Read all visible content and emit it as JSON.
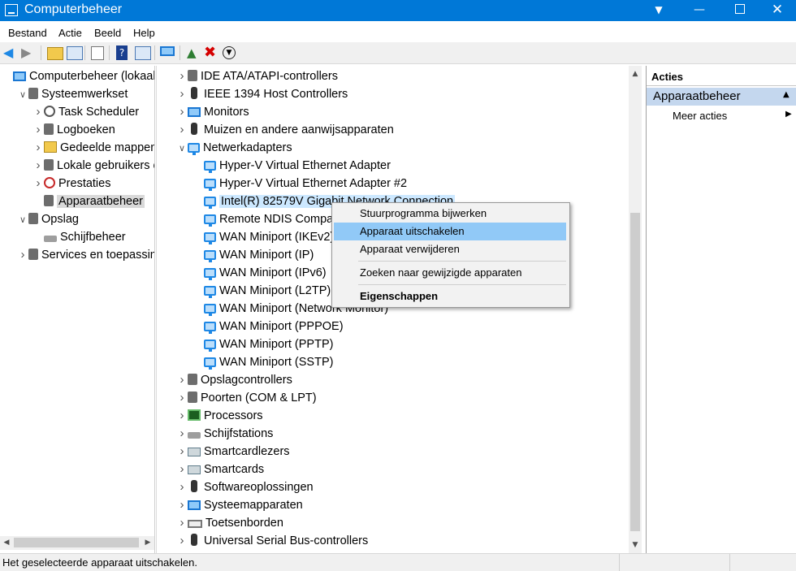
{
  "window": {
    "title": "Computerbeheer",
    "controls": [
      "help-icon",
      "minimize",
      "maximize",
      "close"
    ]
  },
  "menubar": [
    "Bestand",
    "Actie",
    "Beeld",
    "Help"
  ],
  "left_tree": [
    {
      "label": "Computerbeheer (lokaal)",
      "level": 0,
      "expander": "",
      "icon": "computer-icon"
    },
    {
      "label": "Systeemwerkset",
      "level": 1,
      "expander": "expanded",
      "icon": "tools-icon"
    },
    {
      "label": "Task Scheduler",
      "level": 2,
      "expander": "collapsed",
      "icon": "clock-icon"
    },
    {
      "label": "Logboeken",
      "level": 2,
      "expander": "collapsed",
      "icon": "log-icon"
    },
    {
      "label": "Gedeelde mappen",
      "level": 2,
      "expander": "collapsed",
      "icon": "shared-folder-icon"
    },
    {
      "label": "Lokale gebruikers en",
      "level": 2,
      "expander": "collapsed",
      "icon": "users-icon"
    },
    {
      "label": "Prestaties",
      "level": 2,
      "expander": "collapsed",
      "icon": "performance-icon"
    },
    {
      "label": "Apparaatbeheer",
      "level": 2,
      "expander": "",
      "icon": "device-manager-icon",
      "selected": true
    },
    {
      "label": "Opslag",
      "level": 1,
      "expander": "expanded",
      "icon": "storage-icon"
    },
    {
      "label": "Schijfbeheer",
      "level": 2,
      "expander": "",
      "icon": "disk-icon"
    },
    {
      "label": "Services en toepassing",
      "level": 1,
      "expander": "collapsed",
      "icon": "services-icon"
    }
  ],
  "device_tree": [
    {
      "label": "IDE ATA/ATAPI-controllers",
      "indent": 0,
      "expander": "collapsed",
      "icon": "ide-icon"
    },
    {
      "label": "IEEE 1394 Host Controllers",
      "indent": 0,
      "expander": "collapsed",
      "icon": "ieee1394-icon"
    },
    {
      "label": "Monitors",
      "indent": 0,
      "expander": "collapsed",
      "icon": "monitor-icon"
    },
    {
      "label": "Muizen en andere aanwijsapparaten",
      "indent": 0,
      "expander": "collapsed",
      "icon": "mouse-icon"
    },
    {
      "label": "Netwerkadapters",
      "indent": 0,
      "expander": "expanded",
      "icon": "network-icon"
    },
    {
      "label": "Hyper-V Virtual Ethernet Adapter",
      "indent": 1,
      "expander": "",
      "icon": "network-adapter-icon"
    },
    {
      "label": "Hyper-V Virtual Ethernet Adapter #2",
      "indent": 1,
      "expander": "",
      "icon": "network-adapter-icon"
    },
    {
      "label": "Intel(R) 82579V Gigabit Network Connection",
      "indent": 1,
      "expander": "",
      "icon": "network-adapter-icon",
      "selected": true
    },
    {
      "label": "Remote NDIS Compatible Device",
      "indent": 1,
      "expander": "",
      "icon": "network-adapter-icon"
    },
    {
      "label": "WAN Miniport (IKEv2)",
      "indent": 1,
      "expander": "",
      "icon": "network-adapter-icon"
    },
    {
      "label": "WAN Miniport (IP)",
      "indent": 1,
      "expander": "",
      "icon": "network-adapter-icon"
    },
    {
      "label": "WAN Miniport (IPv6)",
      "indent": 1,
      "expander": "",
      "icon": "network-adapter-icon"
    },
    {
      "label": "WAN Miniport (L2TP)",
      "indent": 1,
      "expander": "",
      "icon": "network-adapter-icon"
    },
    {
      "label": "WAN Miniport (Network Monitor)",
      "indent": 1,
      "expander": "",
      "icon": "network-adapter-icon"
    },
    {
      "label": "WAN Miniport (PPPOE)",
      "indent": 1,
      "expander": "",
      "icon": "network-adapter-icon"
    },
    {
      "label": "WAN Miniport (PPTP)",
      "indent": 1,
      "expander": "",
      "icon": "network-adapter-icon"
    },
    {
      "label": "WAN Miniport (SSTP)",
      "indent": 1,
      "expander": "",
      "icon": "network-adapter-icon"
    },
    {
      "label": "Opslagcontrollers",
      "indent": 0,
      "expander": "collapsed",
      "icon": "storage-controller-icon"
    },
    {
      "label": "Poorten (COM & LPT)",
      "indent": 0,
      "expander": "collapsed",
      "icon": "port-icon"
    },
    {
      "label": "Processors",
      "indent": 0,
      "expander": "collapsed",
      "icon": "processor-icon"
    },
    {
      "label": "Schijfstations",
      "indent": 0,
      "expander": "collapsed",
      "icon": "disk-drive-icon"
    },
    {
      "label": "Smartcardlezers",
      "indent": 0,
      "expander": "collapsed",
      "icon": "smartcard-reader-icon"
    },
    {
      "label": "Smartcards",
      "indent": 0,
      "expander": "collapsed",
      "icon": "smartcard-icon"
    },
    {
      "label": "Softwareoplossingen",
      "indent": 0,
      "expander": "collapsed",
      "icon": "software-icon"
    },
    {
      "label": "Systeemapparaten",
      "indent": 0,
      "expander": "collapsed",
      "icon": "system-device-icon"
    },
    {
      "label": "Toetsenborden",
      "indent": 0,
      "expander": "collapsed",
      "icon": "keyboard-icon"
    },
    {
      "label": "Universal Serial Bus-controllers",
      "indent": 0,
      "expander": "collapsed",
      "icon": "usb-icon"
    }
  ],
  "context_menu": [
    {
      "label": "Stuurprogramma bijwerken",
      "type": "item"
    },
    {
      "label": "Apparaat uitschakelen",
      "type": "item",
      "highlighted": true
    },
    {
      "label": "Apparaat verwijderen",
      "type": "item"
    },
    {
      "type": "separator"
    },
    {
      "label": "Zoeken naar gewijzigde apparaten",
      "type": "item"
    },
    {
      "type": "separator"
    },
    {
      "label": "Eigenschappen",
      "type": "item",
      "bold": true
    }
  ],
  "actions_pane": {
    "header": "Acties",
    "section": "Apparaatbeheer",
    "item": "Meer acties"
  },
  "statusbar": {
    "text": "Het geselecteerde apparaat uitschakelen."
  },
  "colors": {
    "titlebar": "#0078d7",
    "selection": "#cce8ff",
    "menu_highlight": "#91c9f7",
    "actions_header": "#c4d7ee"
  }
}
